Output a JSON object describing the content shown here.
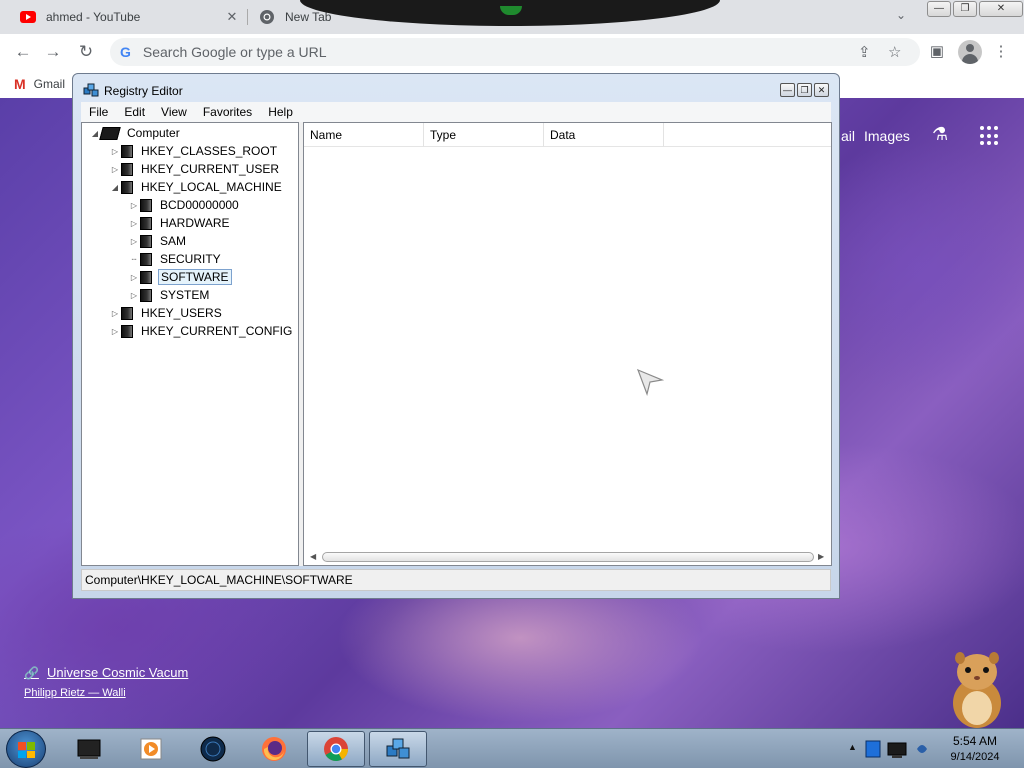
{
  "browser": {
    "tabs": [
      {
        "title": "ahmed - YouTube",
        "close": "✕"
      },
      {
        "title": "New Tab"
      }
    ],
    "omnibox": {
      "placeholder": "Search Google or type a URL",
      "google_letter": "G"
    },
    "bookmarks": [
      {
        "label": "Gmail"
      }
    ],
    "window_controls": [
      "—",
      "❐",
      "✕"
    ]
  },
  "ntp": {
    "links": [
      "ail",
      "Images"
    ],
    "background_credit": {
      "title": "Universe Cosmic Vacum",
      "author": "Philipp Rietz — Walli"
    }
  },
  "regedit": {
    "title": "Registry Editor",
    "menu": [
      "File",
      "Edit",
      "View",
      "Favorites",
      "Help"
    ],
    "tree": {
      "root": "Computer",
      "nodes": [
        {
          "label": "HKEY_CLASSES_ROOT"
        },
        {
          "label": "HKEY_CURRENT_USER"
        },
        {
          "label": "HKEY_LOCAL_MACHINE"
        },
        {
          "label": "BCD00000000"
        },
        {
          "label": "HARDWARE"
        },
        {
          "label": "SAM"
        },
        {
          "label": "SECURITY"
        },
        {
          "label": "SOFTWARE"
        },
        {
          "label": "SYSTEM"
        },
        {
          "label": "HKEY_USERS"
        },
        {
          "label": "HKEY_CURRENT_CONFIG"
        }
      ],
      "selected": "SOFTWARE"
    },
    "list_columns": [
      "Name",
      "Type",
      "Data"
    ],
    "status_path": "Computer\\HKEY_LOCAL_MACHINE\\SOFTWARE"
  },
  "taskbar": {
    "clock_time": "5:54 AM",
    "clock_date": "9/14/2024"
  },
  "colors": {
    "chrome_tabstrip": "#dfe1e5",
    "regedit_frame": "#c7d6ea",
    "taskbar": "#8ea3bb",
    "selection": "#e5f3fb"
  }
}
